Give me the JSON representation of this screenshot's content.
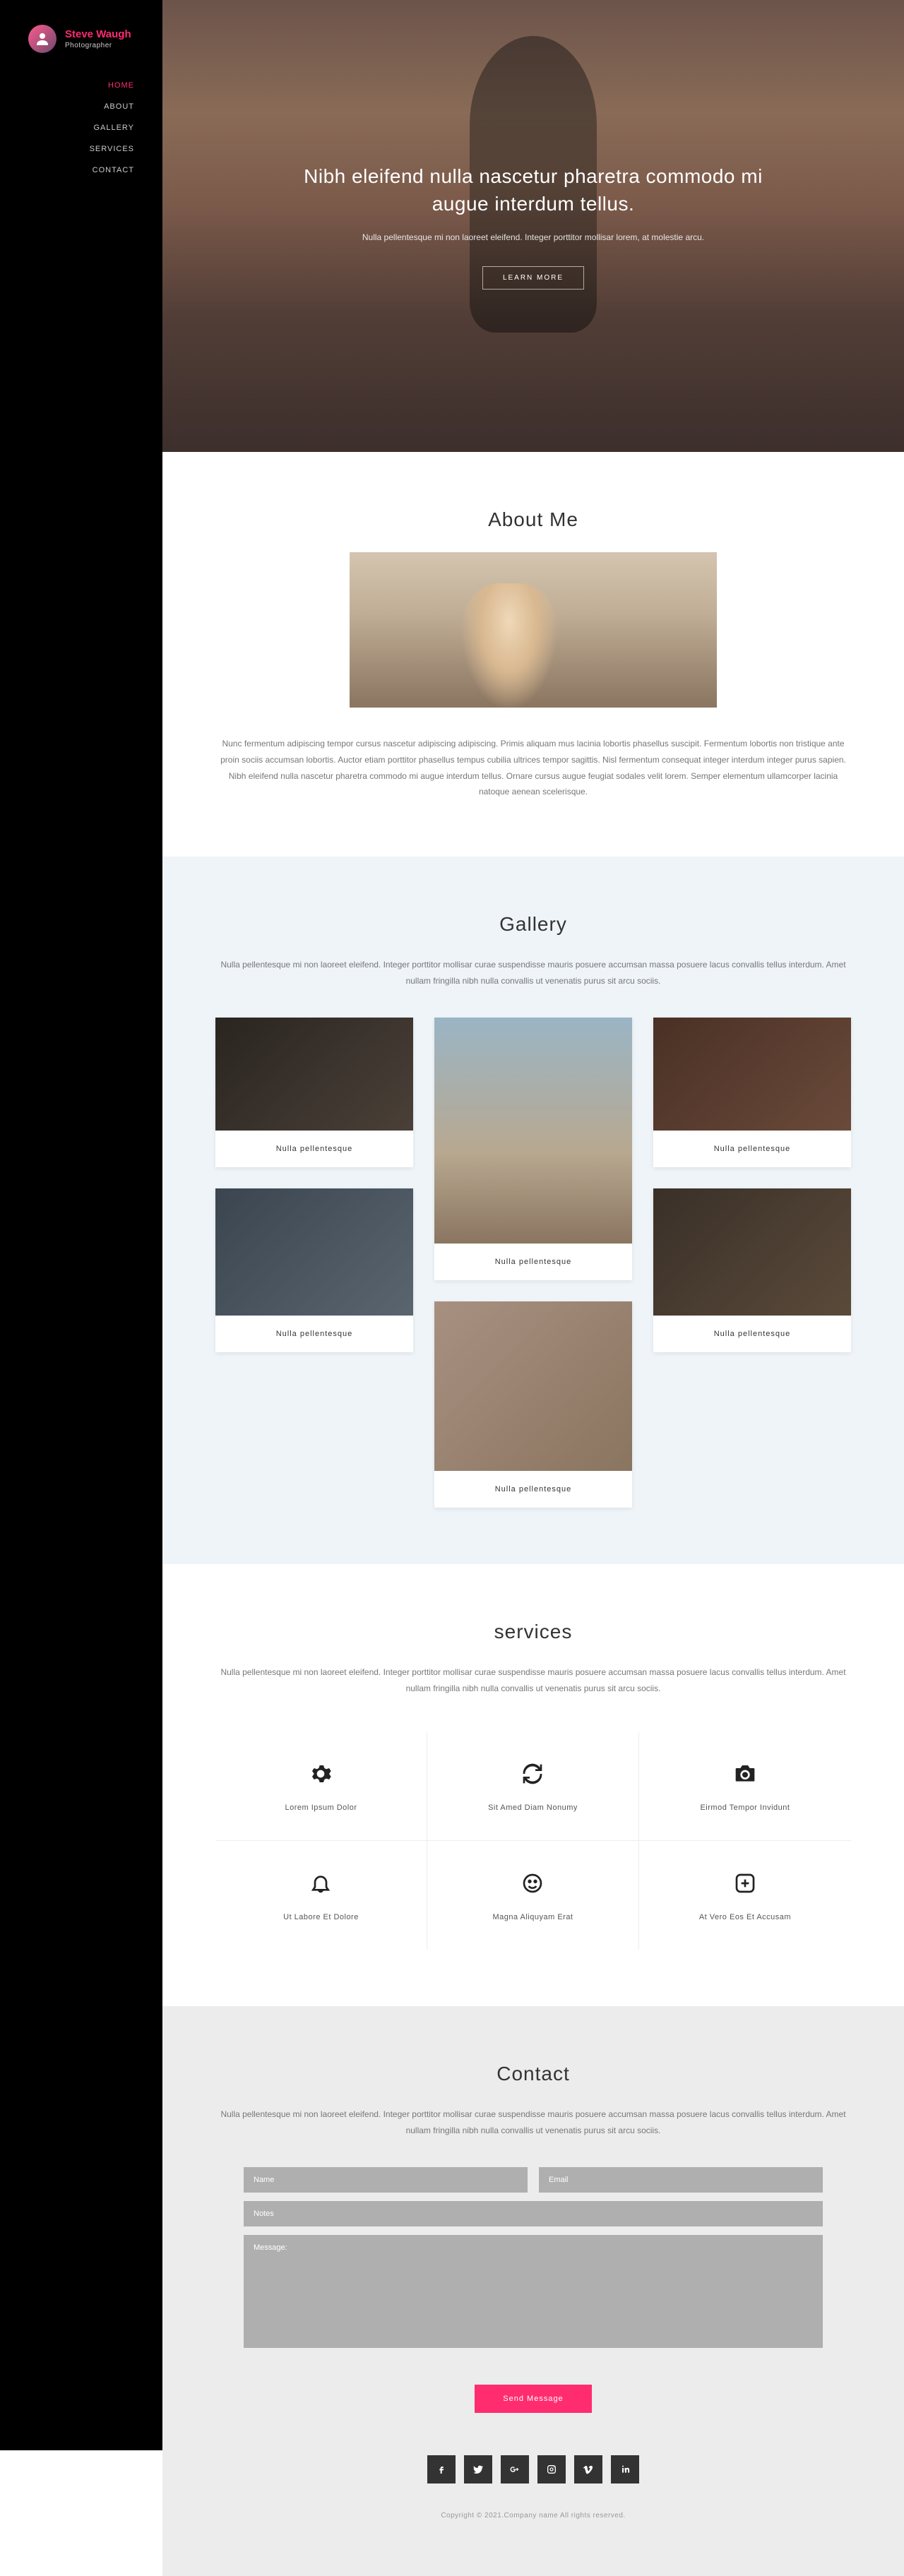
{
  "sidebar": {
    "name": "Steve Waugh",
    "subtitle": "Photographer",
    "nav": [
      {
        "label": "HOME",
        "active": true
      },
      {
        "label": "ABOUT",
        "active": false
      },
      {
        "label": "GALLERY",
        "active": false
      },
      {
        "label": "SERVICES",
        "active": false
      },
      {
        "label": "CONTACT",
        "active": false
      }
    ]
  },
  "hero": {
    "title": "Nibh eleifend nulla nascetur pharetra commodo mi augue interdum tellus.",
    "desc": "Nulla pellentesque mi non laoreet eleifend. Integer porttitor mollisar lorem, at molestie arcu.",
    "button": "LEARN MORE"
  },
  "about": {
    "title": "About Me",
    "desc": "Nunc fermentum adipiscing tempor cursus nascetur adipiscing adipiscing. Primis aliquam mus lacinia lobortis phasellus suscipit. Fermentum lobortis non tristique ante proin sociis accumsan lobortis. Auctor etiam porttitor phasellus tempus cubilia ultrices tempor sagittis. Nisl fermentum consequat integer interdum integer purus sapien. Nibh eleifend nulla nascetur pharetra commodo mi augue interdum tellus. Ornare cursus augue feugiat sodales velit lorem. Semper elementum ullamcorper lacinia natoque aenean scelerisque."
  },
  "gallery": {
    "title": "Gallery",
    "desc": "Nulla pellentesque mi non laoreet eleifend. Integer porttitor mollisar curae suspendisse mauris posuere accumsan massa posuere lacus convallis tellus interdum. Amet nullam fringilla nibh nulla convallis ut venenatis purus sit arcu sociis.",
    "items": [
      {
        "caption": "Nulla pellentesque"
      },
      {
        "caption": "Nulla pellentesque"
      },
      {
        "caption": "Nulla pellentesque"
      },
      {
        "caption": "Nulla pellentesque"
      },
      {
        "caption": "Nulla pellentesque"
      },
      {
        "caption": "Nulla pellentesque"
      }
    ]
  },
  "services": {
    "title": "services",
    "desc": "Nulla pellentesque mi non laoreet eleifend. Integer porttitor mollisar curae suspendisse mauris posuere accumsan massa posuere lacus convallis tellus interdum. Amet nullam fringilla nibh nulla convallis ut venenatis purus sit arcu sociis.",
    "items": [
      {
        "label": "Lorem Ipsum Dolor",
        "icon": "gear-icon"
      },
      {
        "label": "Sit Amed Diam Nonumy",
        "icon": "refresh-icon"
      },
      {
        "label": "Eirmod Tempor Invidunt",
        "icon": "camera-icon"
      },
      {
        "label": "Ut Labore Et Dolore",
        "icon": "bell-icon"
      },
      {
        "label": "Magna Aliquyam Erat",
        "icon": "smile-icon"
      },
      {
        "label": "At Vero Eos Et Accusam",
        "icon": "plus-square-icon"
      }
    ]
  },
  "contact": {
    "title": "Contact",
    "desc": "Nulla pellentesque mi non laoreet eleifend. Integer porttitor mollisar curae suspendisse mauris posuere accumsan massa posuere lacus convallis tellus interdum. Amet nullam fringilla nibh nulla convallis ut venenatis purus sit arcu sociis.",
    "placeholders": {
      "name": "Name",
      "email": "Email",
      "notes": "Notes",
      "message": "Message:"
    },
    "submit": "Send Message"
  },
  "social": [
    "facebook",
    "twitter",
    "google-plus",
    "instagram",
    "vimeo",
    "linkedin"
  ],
  "copyright": "Copyright © 2021.Company name All rights reserved."
}
